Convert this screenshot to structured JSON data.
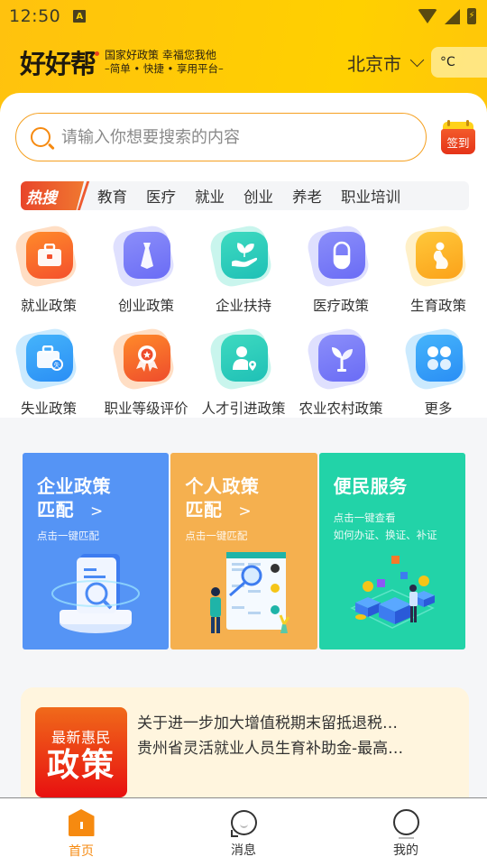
{
  "statusbar": {
    "time": "12:50",
    "notification_icon": "A",
    "battery_glyph": "⚡"
  },
  "header": {
    "logo": "好好帮",
    "slogan_line1": "国家好政策 幸福您我他",
    "slogan_line2": "–简单 • 快捷 • 享用平台–",
    "city": "北京市",
    "temperature_unit": "°C"
  },
  "search": {
    "placeholder": "请输入你想要搜索的内容",
    "value": ""
  },
  "signin": {
    "label": "签到"
  },
  "hot_search": {
    "badge": "热搜",
    "tags": [
      "教育",
      "医疗",
      "就业",
      "创业",
      "养老",
      "职业培训"
    ]
  },
  "categories": [
    {
      "label": "就业政策",
      "icon": "briefcase-icon",
      "color": "#f4502c",
      "color2": "#ff8a2a"
    },
    {
      "label": "创业政策",
      "icon": "tie-icon",
      "color": "#6a6cf5",
      "color2": "#8b8efa"
    },
    {
      "label": "企业扶持",
      "icon": "hand-sprout-icon",
      "color": "#1fc0b6",
      "color2": "#3edac0"
    },
    {
      "label": "医疗政策",
      "icon": "pill-icon",
      "color": "#6a6cf5",
      "color2": "#8b8efa"
    },
    {
      "label": "生育政策",
      "icon": "pregnant-woman-icon",
      "color": "#fba21a",
      "color2": "#ffc83a"
    },
    {
      "label": "失业政策",
      "icon": "briefcase-badge-icon",
      "color": "#2a8ef5",
      "color2": "#45b4fb"
    },
    {
      "label": "职业等级评价",
      "icon": "award-medal-icon",
      "color": "#ee4c2c",
      "color2": "#ff8a2a"
    },
    {
      "label": "人才引进政策",
      "icon": "person-location-icon",
      "color": "#1fc0b6",
      "color2": "#3edac0"
    },
    {
      "label": "农业农村政策",
      "icon": "sprout-icon",
      "color": "#6a6cf5",
      "color2": "#8b8efa"
    },
    {
      "label": "更多",
      "icon": "more-grid-icon",
      "color": "#2a8ef5",
      "color2": "#45b4fb"
    }
  ],
  "features": [
    {
      "title1": "企业政策",
      "title2": "匹配",
      "arrow": ">",
      "sub1": "点击一键匹配",
      "sub2": "",
      "color": "#5594f5"
    },
    {
      "title1": "个人政策",
      "title2": "匹配",
      "arrow": ">",
      "sub1": "点击一键匹配",
      "sub2": "",
      "color": "#f5b04f"
    },
    {
      "title1": "便民服务",
      "title2": "",
      "arrow": "",
      "sub1": "点击一键查看",
      "sub2": "如何办证、换证、补证",
      "color": "#22d3a8"
    }
  ],
  "news": {
    "badge_line1": "最新惠民",
    "badge_line2": "政策",
    "items": [
      "关于进一步加大增值税期末留抵退税…",
      "贵州省灵活就业人员生育补助金-最高…"
    ]
  },
  "tabbar": {
    "tabs": [
      {
        "label": "首页",
        "active": true
      },
      {
        "label": "消息",
        "active": false
      },
      {
        "label": "我的",
        "active": false
      }
    ],
    "active_color": "#f68a10"
  }
}
